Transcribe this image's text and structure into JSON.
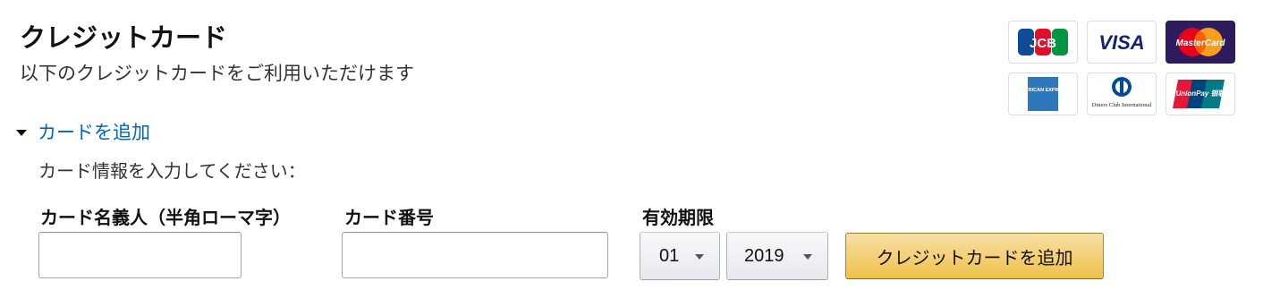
{
  "header": {
    "title": "クレジットカード",
    "subtitle": "以下のクレジットカードをご利用いただけます"
  },
  "accepted_cards": [
    {
      "name": "jcb-logo",
      "text": "JCB"
    },
    {
      "name": "visa-logo",
      "text": "VISA"
    },
    {
      "name": "mastercard-logo",
      "text": "MasterCard"
    },
    {
      "name": "amex-logo",
      "text": "AMERICAN EXPRESS"
    },
    {
      "name": "diners-club-logo",
      "text": "Diners Club International"
    },
    {
      "name": "unionpay-logo",
      "text": "UnionPay 银联"
    }
  ],
  "add_card": {
    "expander_label": "カードを追加",
    "prompt": "カード情報を入力してください：",
    "cardholder_label": "カード名義人（半角ローマ字）",
    "cardholder_value": "",
    "card_number_label": "カード番号",
    "card_number_value": "",
    "expiry_label": "有効期限",
    "expiry_month": "01",
    "expiry_year": "2019",
    "submit_label": "クレジットカードを追加"
  },
  "colors": {
    "link": "#0066c0",
    "button_gradient_top": "#f7dfa5",
    "button_gradient_bottom": "#f0c14b",
    "mastercard_bg": "#2e1b5b",
    "jcb_blue": "#0e4c96",
    "visa_blue": "#1a1f71"
  },
  "icons": {
    "expander": "caret-down-icon",
    "dropdown": "chevron-down-icon"
  }
}
